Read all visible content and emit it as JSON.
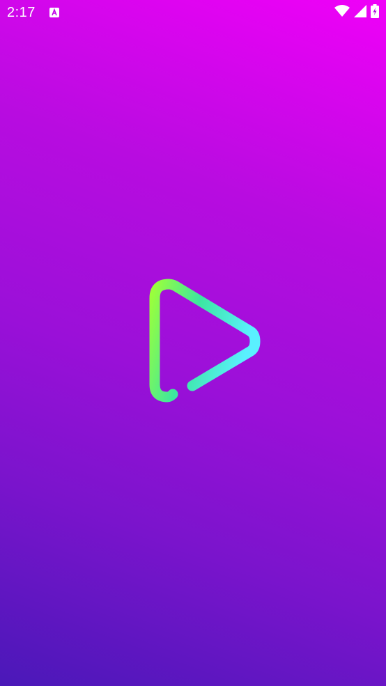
{
  "status_bar": {
    "time": "2:17",
    "icons": [
      "accessibility-app-icon",
      "wifi-icon",
      "cell-signal-icon",
      "battery-charging-icon"
    ]
  },
  "splash": {
    "logo_icon": "play-logo-icon",
    "gradient_colors": [
      "#f000f8",
      "#4a18b8"
    ],
    "logo_colors": [
      "#9aff3c",
      "#3ce6a0",
      "#5af0ff"
    ]
  }
}
